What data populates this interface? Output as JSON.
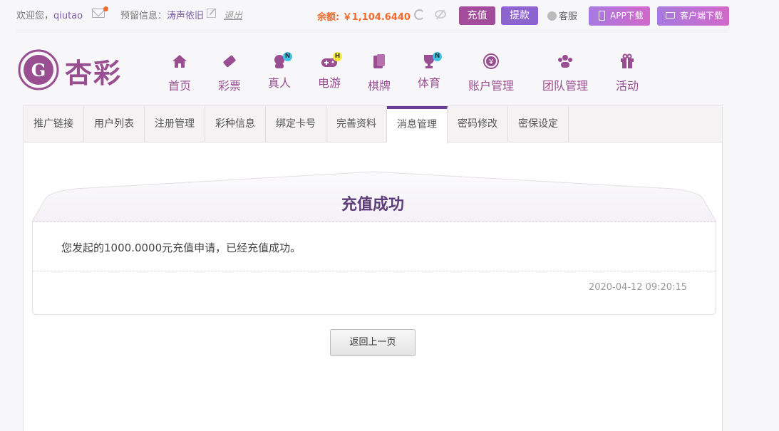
{
  "topbar": {
    "welcome_prefix": "欢迎您，",
    "username": "qiutao",
    "reserve_label": "预留信息：",
    "reserve_value": "涛声依旧",
    "logout": "退出",
    "balance": "余额: ￥1,104.6440",
    "recharge": "充值",
    "withdraw": "提款",
    "customer_service": "客服",
    "app_download": "APP下载",
    "client_download": "客户端下载"
  },
  "logo": {
    "text": "杏彩"
  },
  "nav": [
    {
      "label": "首页",
      "icon": "home-icon"
    },
    {
      "label": "彩票",
      "icon": "ticket-icon"
    },
    {
      "label": "真人",
      "icon": "dealer-icon",
      "badge": "N"
    },
    {
      "label": "电游",
      "icon": "gamepad-icon",
      "badge": "H"
    },
    {
      "label": "棋牌",
      "icon": "cards-icon"
    },
    {
      "label": "体育",
      "icon": "trophy-icon",
      "badge": "N"
    },
    {
      "label": "账户管理",
      "icon": "yen-icon"
    },
    {
      "label": "团队管理",
      "icon": "team-icon"
    },
    {
      "label": "活动",
      "icon": "gift-icon"
    }
  ],
  "tabs": [
    "推广链接",
    "用户列表",
    "注册管理",
    "彩种信息",
    "绑定卡号",
    "完善资料",
    "消息管理",
    "密码修改",
    "密保设定"
  ],
  "active_tab": "消息管理",
  "message": {
    "title": "充值成功",
    "body": "您发起的1000.0000元充值申请，已经充值成功。",
    "time": "2020-04-12 09:20:15"
  },
  "back_button": "返回上一页",
  "colors": {
    "brand": "#9a4e92",
    "accent": "#f26a2b",
    "tab_active": "#6a3f95"
  }
}
